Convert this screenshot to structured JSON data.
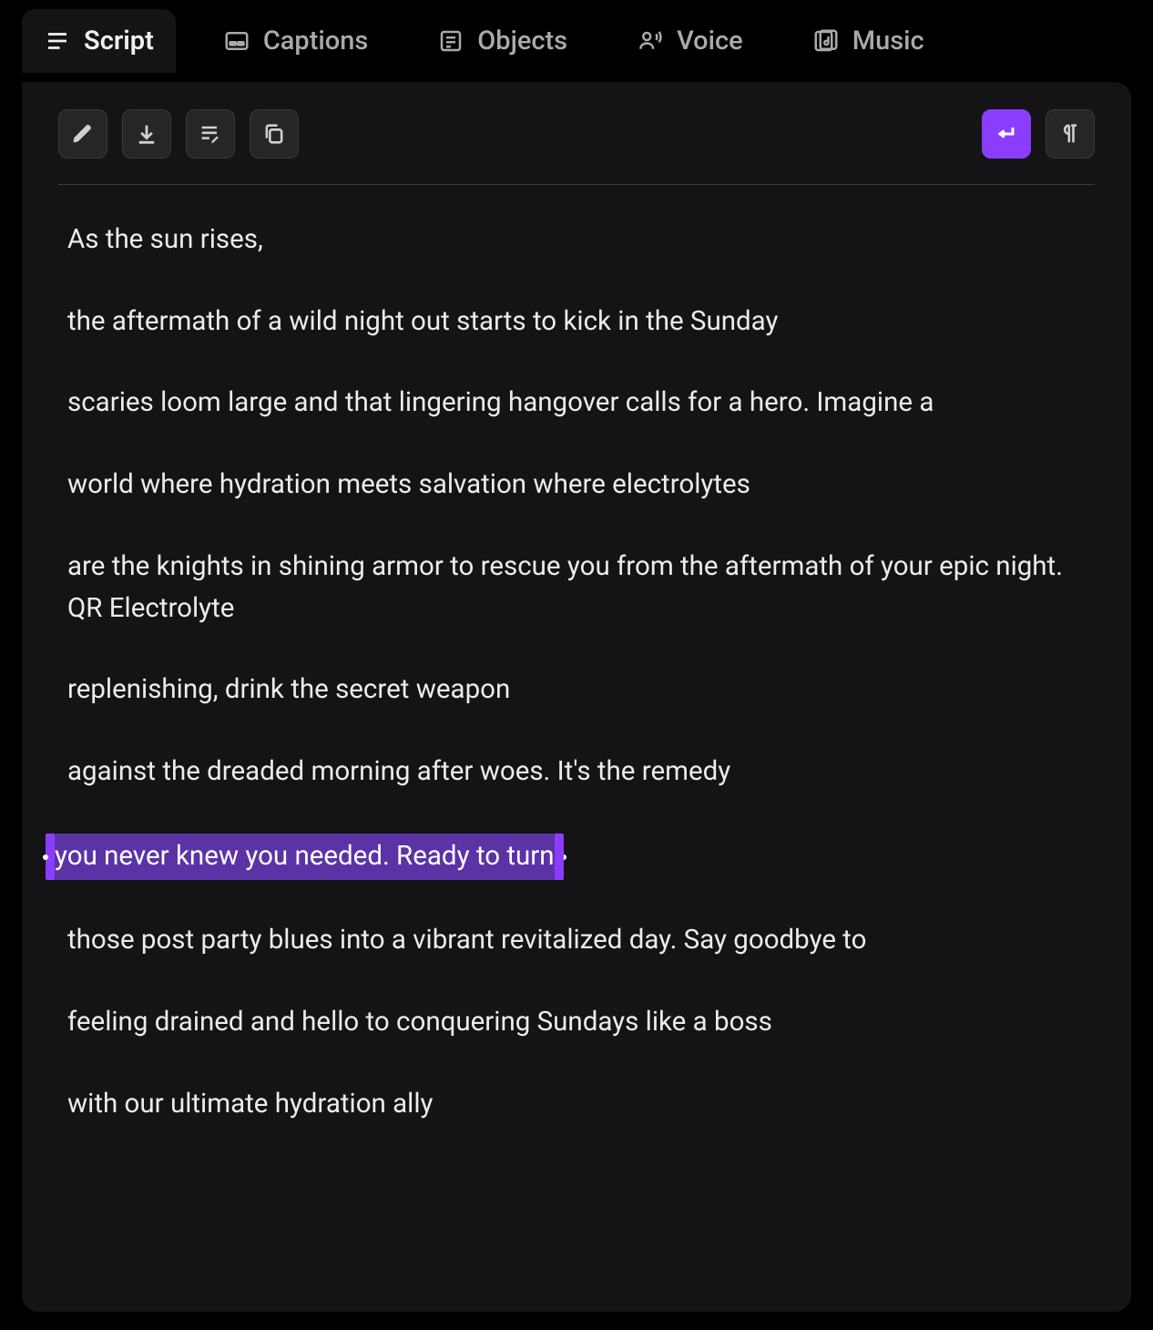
{
  "tabs": {
    "script": {
      "label": "Script"
    },
    "captions": {
      "label": "Captions"
    },
    "objects": {
      "label": "Objects"
    },
    "voice": {
      "label": "Voice"
    },
    "music": {
      "label": "Music"
    }
  },
  "toolbar": {
    "edit_icon": "edit",
    "download_icon": "download",
    "list_edit_icon": "list-edit",
    "copy_icon": "copy",
    "enter_icon": "enter",
    "pilcrow_icon": "pilcrow"
  },
  "script": {
    "lines": [
      "As the sun rises,",
      "the aftermath of a wild night out starts to kick in the Sunday",
      "scaries loom large and that lingering hangover calls for a hero. Imagine a",
      "world where hydration meets salvation where electrolytes",
      "are the knights in shining armor to rescue you from the aftermath of your epic night. QR Electrolyte",
      "replenishing, drink the secret weapon",
      "against the dreaded morning after woes. It's the remedy",
      "you never knew you needed. Ready to turn",
      "those post party blues into a vibrant revitalized day. Say goodbye to",
      "feeling drained and hello to conquering Sundays like a boss",
      "with our ultimate hydration ally"
    ],
    "selected_index": 7
  },
  "colors": {
    "accent": "#8b3dff",
    "selection_bg": "#5b33a5",
    "panel_bg": "#141416",
    "btn_bg": "#262629"
  }
}
